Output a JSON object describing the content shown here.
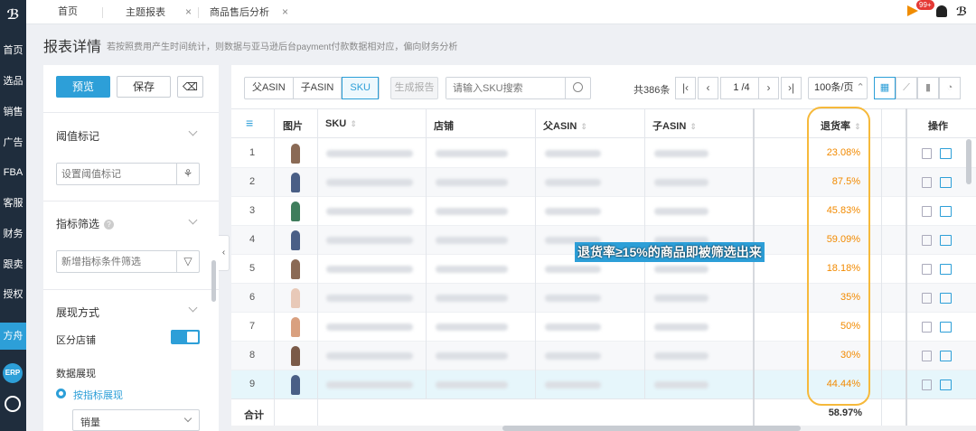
{
  "nav": {
    "items": [
      "首页",
      "选品",
      "销售",
      "广告",
      "FBA",
      "客服",
      "财务",
      "跟卖",
      "授权",
      "方舟"
    ],
    "erp": "ERP"
  },
  "tabs": [
    {
      "label": "首页"
    },
    {
      "label": "主题报表"
    },
    {
      "label": "商品售后分析"
    }
  ],
  "notifications": {
    "badge": "99+"
  },
  "header": {
    "title": "报表详情",
    "desc": "若按照费用产生时间统计，则数据与亚马逊后台payment付款数据相对应，偏向财务分析"
  },
  "left_panel": {
    "preview": "预览",
    "save": "保存",
    "threshold_title": "阈值标记",
    "threshold_placeholder": "设置阈值标记",
    "filter_title": "指标筛选",
    "filter_placeholder": "新增指标条件筛选",
    "display_title": "展现方式",
    "split_store": "区分店铺",
    "data_display": "数据展现",
    "by_metric": "按指标展现",
    "metric_select": "销量"
  },
  "toolbar": {
    "seg": [
      "父ASIN",
      "子ASIN",
      "SKU"
    ],
    "generate": "生成报告",
    "search_placeholder": "请输入SKU搜索",
    "total": "共386条",
    "page_current": "1",
    "page_total": "/4",
    "page_size": "100条/页"
  },
  "table": {
    "headers": {
      "img": "图片",
      "sku": "SKU",
      "store": "店铺",
      "parent": "父ASIN",
      "child": "子ASIN",
      "rate": "退货率",
      "ops": "操作"
    },
    "rows": [
      {
        "idx": "1",
        "rate": "23.08%"
      },
      {
        "idx": "2",
        "rate": "87.5%"
      },
      {
        "idx": "3",
        "rate": "45.83%"
      },
      {
        "idx": "4",
        "rate": "59.09%"
      },
      {
        "idx": "5",
        "rate": "18.18%"
      },
      {
        "idx": "6",
        "rate": "35%"
      },
      {
        "idx": "7",
        "rate": "50%"
      },
      {
        "idx": "8",
        "rate": "30%"
      },
      {
        "idx": "9",
        "rate": "44.44%"
      }
    ],
    "footer_label": "合计",
    "footer_rate": "58.97%"
  },
  "annotation": "退货率≥15%的商品即被筛选出来",
  "colors": {
    "accent": "#2d9fd8",
    "rate": "#f28a00",
    "outline": "#f6b93b"
  }
}
